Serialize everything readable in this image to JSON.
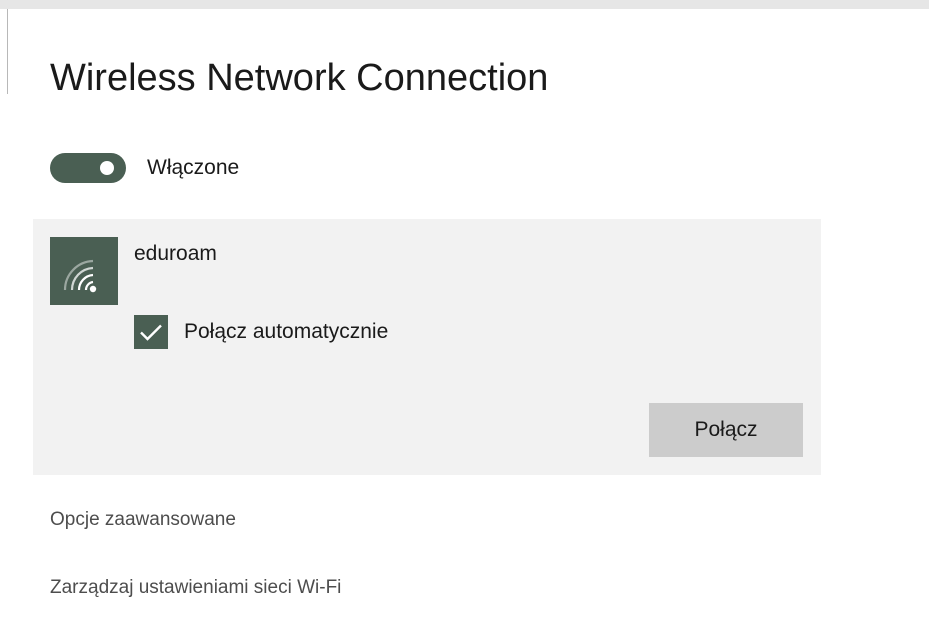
{
  "colors": {
    "accent": "#4a5f53",
    "card_bg": "#f2f2f2",
    "button_bg": "#cccccc"
  },
  "page": {
    "title": "Wireless Network Connection"
  },
  "wifi_toggle": {
    "state": "on",
    "label": "Włączone"
  },
  "network": {
    "icon": "wifi-signal-icon",
    "name": "eduroam",
    "auto_connect": {
      "checked": true,
      "label": "Połącz automatycznie"
    },
    "connect_label": "Połącz"
  },
  "links": {
    "advanced": "Opcje zaawansowane",
    "manage": "Zarządzaj ustawieniami sieci Wi-Fi"
  }
}
